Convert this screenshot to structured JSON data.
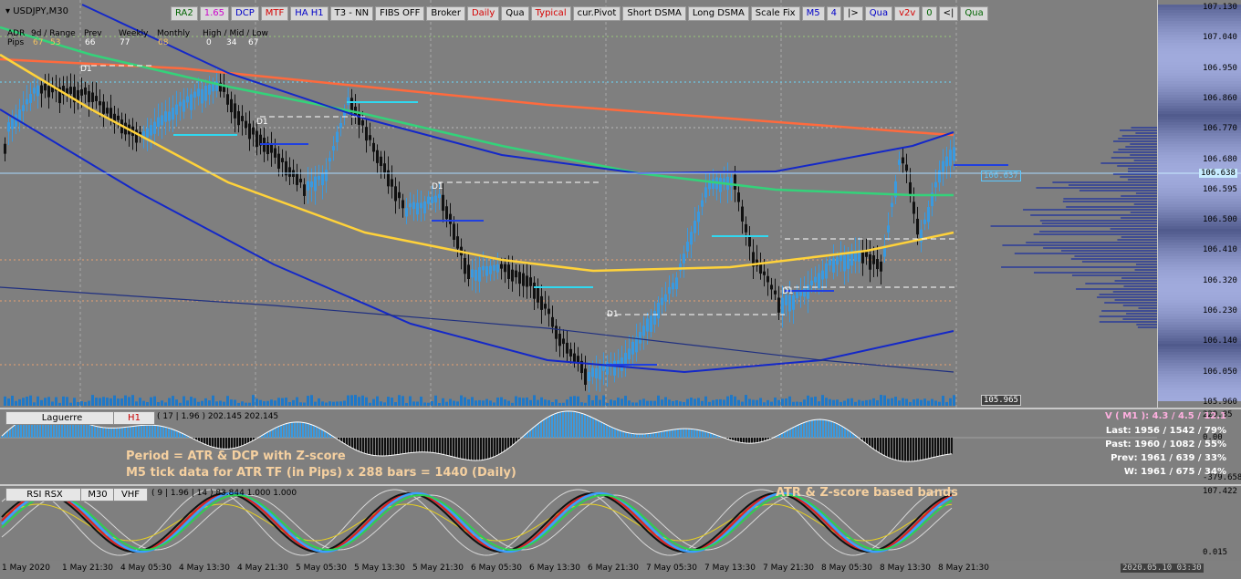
{
  "chart_title": "USDJPY,M30",
  "toolbar": [
    {
      "label": "RA2",
      "style": "green"
    },
    {
      "label": "1.65",
      "style": "magenta"
    },
    {
      "label": "DCP",
      "style": "blue"
    },
    {
      "label": "MTF",
      "style": "red"
    },
    {
      "label": "HA H1",
      "style": "blue"
    },
    {
      "label": "T3 - NN",
      "style": ""
    },
    {
      "label": "FIBS OFF",
      "style": ""
    },
    {
      "label": "Broker",
      "style": ""
    },
    {
      "label": "Daily",
      "style": "red"
    },
    {
      "label": "Qua",
      "style": ""
    },
    {
      "label": "Typical",
      "style": "red"
    },
    {
      "label": "cur.Pivot",
      "style": ""
    },
    {
      "label": "Short DSMA",
      "style": ""
    },
    {
      "label": "Long DSMA",
      "style": ""
    },
    {
      "label": "Scale Fix",
      "style": ""
    },
    {
      "label": "M5",
      "style": "blue"
    },
    {
      "label": "4",
      "style": "blue"
    },
    {
      "label": "|>",
      "style": ""
    },
    {
      "label": "Qua",
      "style": "blue"
    },
    {
      "label": "v2v",
      "style": "red"
    },
    {
      "label": "0",
      "style": "green"
    },
    {
      "label": "<|",
      "style": ""
    },
    {
      "label": "Qua",
      "style": "green"
    }
  ],
  "stats": {
    "headers": [
      "ADR",
      "9d / Range",
      "Prev",
      "Weekly",
      "Monthly",
      "High / Mid / Low"
    ],
    "row_label": "Pips",
    "values": [
      "67",
      "53",
      "66",
      "77",
      "68",
      "0",
      "34",
      "67"
    ]
  },
  "price_axis": [
    "107.130",
    "107.040",
    "106.950",
    "106.860",
    "106.770",
    "106.680",
    "106.595",
    "106.500",
    "106.410",
    "106.320",
    "106.230",
    "106.140",
    "106.050",
    "105.960"
  ],
  "current_price": "106.638",
  "price_tag_right": "106.637",
  "low_tag": "105.965",
  "d1_labels": [
    "D1",
    "D1",
    "D1",
    "D1",
    "D1"
  ],
  "time_axis": [
    "1 May 2020",
    "1 May 21:30",
    "4 May 05:30",
    "4 May 13:30",
    "4 May 21:30",
    "5 May 05:30",
    "5 May 13:30",
    "5 May 21:30",
    "6 May 05:30",
    "6 May 13:30",
    "6 May 21:30",
    "7 May 05:30",
    "7 May 13:30",
    "7 May 21:30",
    "8 May 05:30",
    "8 May 13:30",
    "8 May 21:30"
  ],
  "time_box": "2020.05.10 03:30",
  "laguerre": {
    "name": "Laguerre",
    "tf": "H1",
    "params": "( 17 | 1.96 ) 202.145 202.145",
    "axis_top": "229.85",
    "axis_mid": "0.00",
    "axis_bottom": "-379.658",
    "annot1": "Period = ATR  & DCP with Z-score",
    "annot2": "M5 tick data for ATR TF (in Pips)  x  288 bars = 1440 (Daily)",
    "stats": [
      {
        "text": "V ( M1 ): 4.3 / 4.5 / 12.1",
        "color": "#ffb0e0"
      },
      {
        "text": "Last: 1956 / 1542 / 79%",
        "color": "#ffffff"
      },
      {
        "text": "Past: 1960 / 1082 / 55%",
        "color": "#ffffff"
      },
      {
        "text": "Prev: 1961 / 639 / 33%",
        "color": "#ffffff"
      },
      {
        "text": "W: 1961 / 675 / 34%",
        "color": "#ffffff"
      }
    ]
  },
  "rsi": {
    "name": "RSI RSX",
    "tf": "M30",
    "vhf": "VHF",
    "params": "( 9 | 1.96 | 14 ) 83.844 1.000 1.000",
    "axis_top": "107.422",
    "axis_bottom": "0.015",
    "annot": "ATR & Z-score based bands"
  },
  "colors": {
    "ma_red": "#ff6a3d",
    "ma_green": "#34d27a",
    "ma_yellow": "#ffd23a",
    "ma_blue": "#1428c8",
    "candle_up": "#3a9ae0",
    "candle_down": "#111111"
  }
}
